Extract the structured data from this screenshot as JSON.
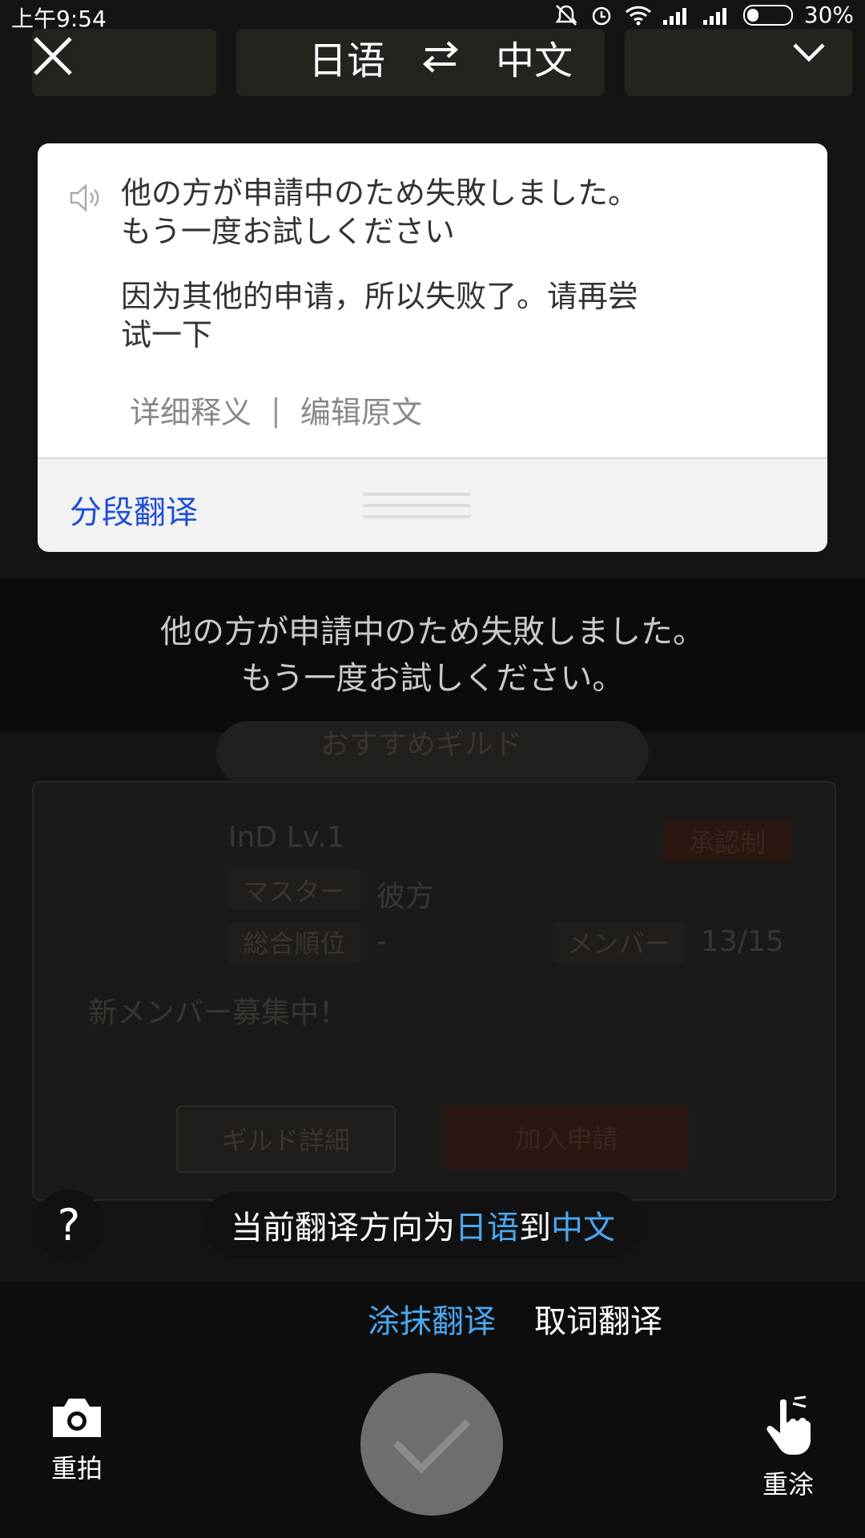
{
  "status_bar": {
    "time": "上午9:54",
    "battery": "30%"
  },
  "header": {
    "source_lang": "日语",
    "target_lang": "中文"
  },
  "result_card": {
    "source_text": "他の方が申請中のため失敗しました。もう一度お試しください",
    "translation": "因为其他的申请，所以失败了。请再尝试一下",
    "link_details": "详细释义",
    "link_separator": "|",
    "link_edit": "编辑原文",
    "segment_button": "分段翻译"
  },
  "ocr_overlay": {
    "line1": "他の方が申請中のため失敗しました。",
    "line2": "もう一度お試しください。"
  },
  "background_game": {
    "guild_title": "おすすめギルド",
    "guild_name": "InD Lv.1",
    "master_label": "マスター",
    "master_value": "彼方",
    "rank_label": "総合順位",
    "rank_value": "-",
    "approval_badge": "承認制",
    "members_label": "メンバー",
    "members_value": "13/15",
    "recruit_text": "新メンバー募集中！",
    "details_button": "ギルド詳細",
    "join_button": "加入申請"
  },
  "tip": {
    "prefix": "当前翻译方向为",
    "from": "日语",
    "middle": "到",
    "to": "中文"
  },
  "help": {
    "label": "?"
  },
  "modes": {
    "smear": "涂抹翻译",
    "word": "取词翻译"
  },
  "bottom": {
    "retake": "重拍",
    "repaint": "重涂"
  },
  "colors": {
    "accent_blue": "#4aa8f0",
    "link_blue": "#1f4fd6",
    "confirm_gray": "#6e6e6e"
  }
}
